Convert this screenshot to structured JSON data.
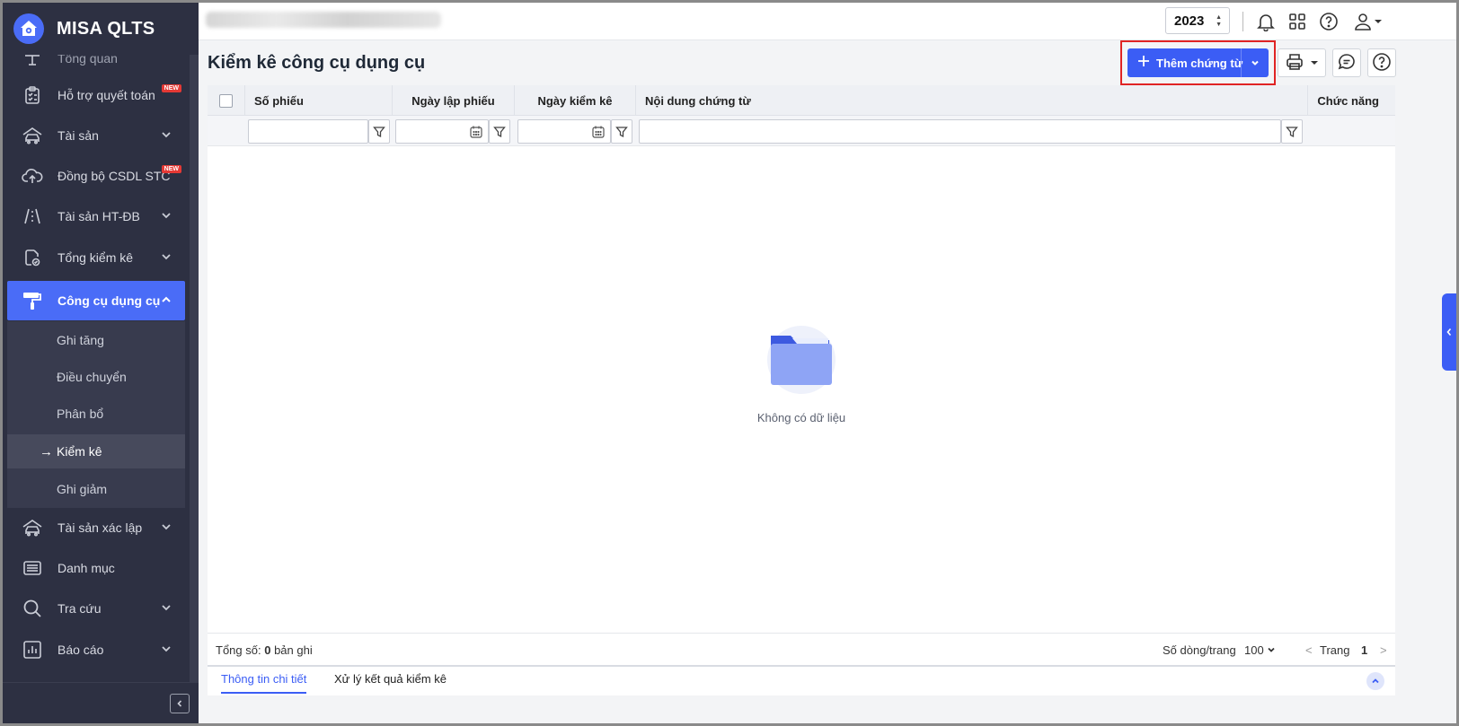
{
  "app": {
    "name": "MISA QLTS",
    "year": "2023"
  },
  "sidebar": {
    "items": [
      {
        "label": "Tổng quan",
        "icon": "dashboard-icon"
      },
      {
        "label": "Hỗ trợ quyết toán",
        "icon": "clipboard-check-icon",
        "badge": "NEW"
      },
      {
        "label": "Tài sản",
        "icon": "car-house-icon"
      },
      {
        "label": "Đồng bộ CSDL STC",
        "icon": "cloud-upload-icon",
        "badge": "NEW"
      },
      {
        "label": "Tài sản HT-ĐB",
        "icon": "road-icon"
      },
      {
        "label": "Tổng kiểm kê",
        "icon": "document-check-icon"
      },
      {
        "label": "Công cụ dụng cụ",
        "icon": "paint-roller-icon"
      },
      {
        "label": "Tài sản xác lập",
        "icon": "car-house-icon"
      },
      {
        "label": "Danh mục",
        "icon": "list-icon"
      },
      {
        "label": "Tra cứu",
        "icon": "search-icon"
      },
      {
        "label": "Báo cáo",
        "icon": "report-chart-icon"
      }
    ],
    "submenu": [
      {
        "label": "Ghi tăng"
      },
      {
        "label": "Điều chuyển"
      },
      {
        "label": "Phân bổ"
      },
      {
        "label": "Kiểm kê"
      },
      {
        "label": "Ghi giảm"
      }
    ]
  },
  "page": {
    "title": "Kiểm kê công cụ dụng cụ",
    "add_button": "Thêm chứng từ"
  },
  "grid": {
    "columns": [
      "Số phiếu",
      "Ngày lập phiếu",
      "Ngày kiểm kê",
      "Nội dung chứng từ",
      "Chức năng"
    ],
    "empty_text": "Không có dữ liệu"
  },
  "footer": {
    "total_prefix": "Tổng số:",
    "total_count": "0",
    "total_suffix": "bản ghi",
    "rows_per_page_label": "Số dòng/trang",
    "rows_per_page": "100",
    "page_label": "Trang",
    "page_number": "1"
  },
  "bottom_tabs": [
    {
      "label": "Thông tin chi tiết"
    },
    {
      "label": "Xử lý kết quả kiểm kê"
    }
  ],
  "colors": {
    "primary": "#3b5df5",
    "sidebar_bg": "#2d3042",
    "highlight": "#e02424"
  }
}
